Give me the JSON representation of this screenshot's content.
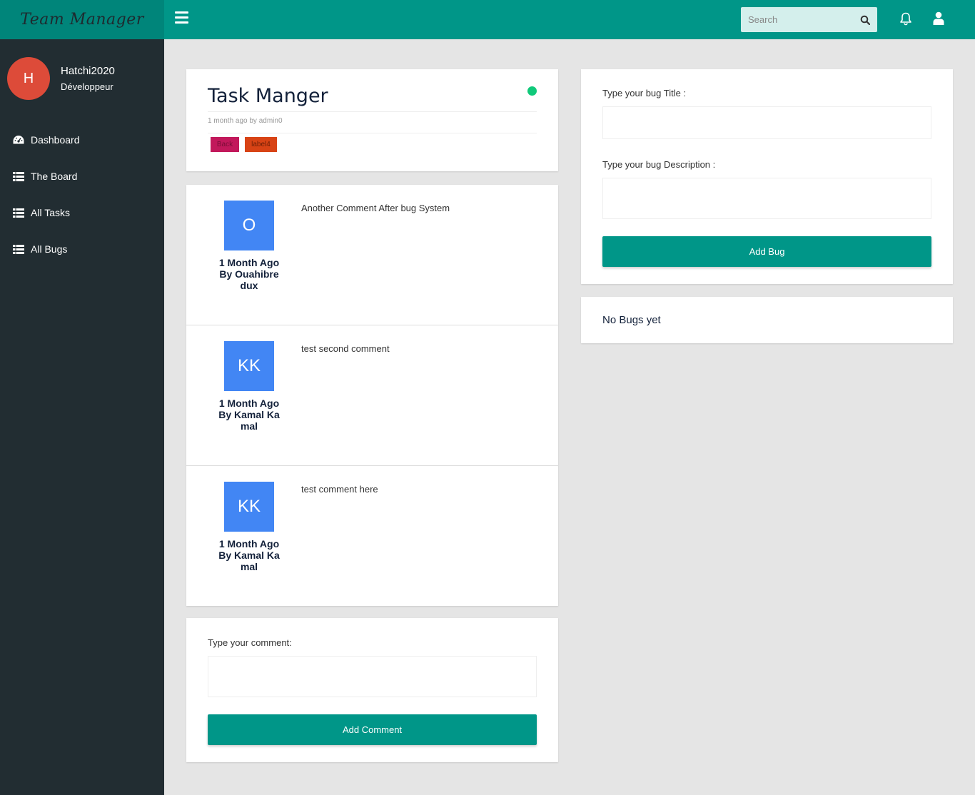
{
  "app": {
    "brand": "Team Manager"
  },
  "topbar": {
    "search_placeholder": "Search"
  },
  "user": {
    "initial": "H",
    "name": "Hatchi2020",
    "role": "Développeur",
    "avatar_color": "#dd4b39"
  },
  "sidebar": {
    "items": [
      {
        "label": "Dashboard",
        "icon": "dashboard-icon"
      },
      {
        "label": "The Board",
        "icon": "list-icon"
      },
      {
        "label": "All Tasks",
        "icon": "list-icon"
      },
      {
        "label": "All Bugs",
        "icon": "list-icon"
      }
    ]
  },
  "task": {
    "title": "Task Manger",
    "meta": "1 month ago by  admin0",
    "status_color": "#10c97a",
    "tags": [
      {
        "label": "Back",
        "color": "#c2185b"
      },
      {
        "label": "label4",
        "color": "#d84315"
      }
    ]
  },
  "comments": [
    {
      "initials": "O",
      "meta": "1 Month Ago By Ouahibredux",
      "text": "Another Comment After bug System"
    },
    {
      "initials": "KK",
      "meta": "1 Month Ago By Kamal Kamal",
      "text": "test second comment"
    },
    {
      "initials": "KK",
      "meta": "1 Month Ago By Kamal Kamal",
      "text": "test comment here"
    }
  ],
  "comment_form": {
    "label": "Type your comment:",
    "value": "",
    "button": "Add Comment"
  },
  "bug_form": {
    "title_label": "Type your bug Title :",
    "title_value": "",
    "description_label": "Type your bug Description :",
    "description_value": "",
    "button": "Add Bug"
  },
  "bugs": {
    "empty_text": "No Bugs yet"
  },
  "colors": {
    "primary": "#009688",
    "sidebar_bg": "#222d32",
    "comment_avatar": "#4286f4"
  }
}
